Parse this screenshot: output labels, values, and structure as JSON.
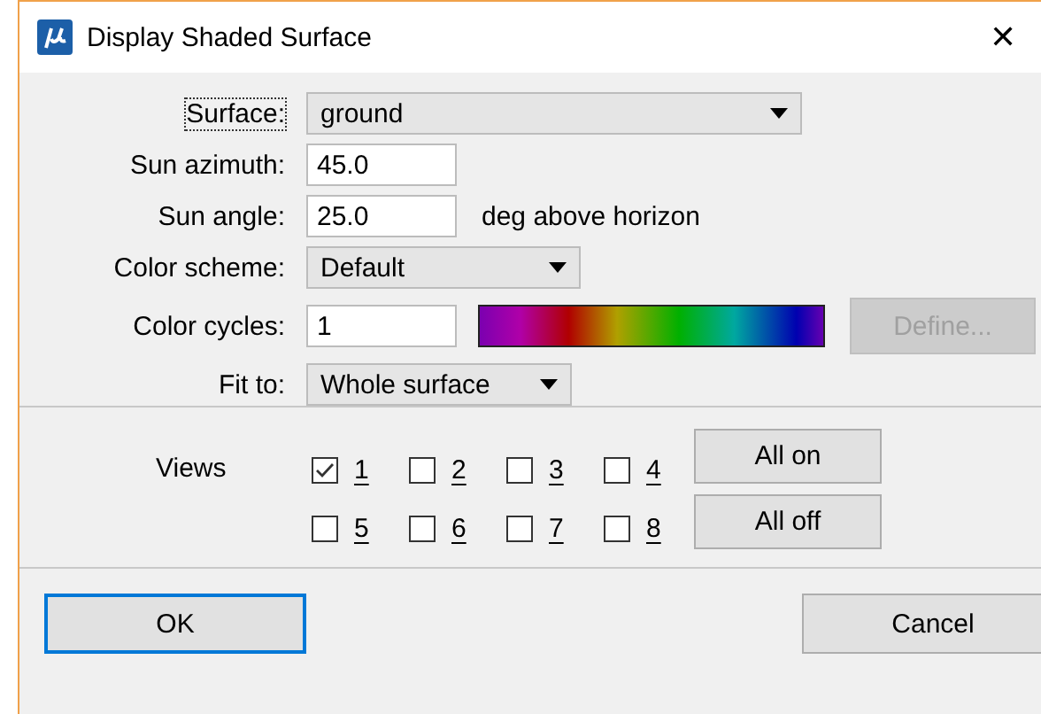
{
  "window": {
    "title": "Display Shaded Surface",
    "close": "✕"
  },
  "fields": [
    {
      "kind": "combo",
      "label": "Surface:",
      "value": "ground",
      "focused": true
    },
    {
      "kind": "text",
      "label": "Sun azimuth:",
      "value": "45.0"
    },
    {
      "kind": "text",
      "label": "Sun angle:",
      "value": "25.0",
      "suffix": "deg above horizon"
    },
    {
      "kind": "combo",
      "label": "Color scheme:",
      "value": "Default"
    },
    {
      "kind": "ramp",
      "label": "Color cycles:",
      "value": "1",
      "button": {
        "label": "Define...",
        "disabled": true
      }
    },
    {
      "kind": "combo",
      "label": "Fit to:",
      "value": "Whole surface"
    }
  ],
  "views": {
    "label": "Views",
    "items": [
      {
        "label": "1",
        "checked": true
      },
      {
        "label": "2",
        "checked": false
      },
      {
        "label": "3",
        "checked": false
      },
      {
        "label": "4",
        "checked": false
      },
      {
        "label": "5",
        "checked": false
      },
      {
        "label": "6",
        "checked": false
      },
      {
        "label": "7",
        "checked": false
      },
      {
        "label": "8",
        "checked": false
      }
    ],
    "buttons": [
      {
        "label": "All on"
      },
      {
        "label": "All off"
      }
    ]
  },
  "buttons": [
    {
      "label": "OK",
      "default": true
    },
    {
      "label": "Cancel",
      "default": false
    }
  ]
}
